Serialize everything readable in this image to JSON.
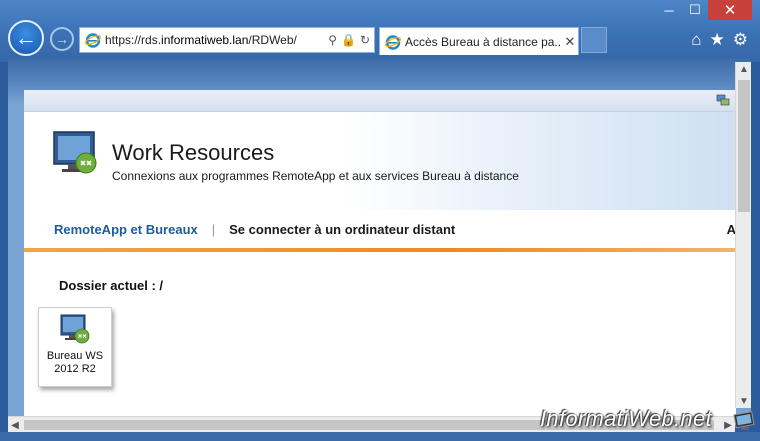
{
  "window": {
    "controls": {
      "minimize": "─",
      "maximize": "☐",
      "close": "✕"
    }
  },
  "browser": {
    "address": {
      "prefix": "https://rds.",
      "domain": "informatiweb.lan",
      "path": "/RDWeb/",
      "icons": [
        "search-icon",
        "lock-icon",
        "refresh-icon"
      ]
    },
    "tab": {
      "title": "Accès Bureau à distance pa...",
      "close": "✕"
    },
    "tools": [
      "home-icon",
      "favorites-star-icon",
      "settings-gear-icon"
    ]
  },
  "page": {
    "header": {
      "title": "Work Resources",
      "subtitle": "Connexions aux programmes RemoteApp et aux services Bureau à distance"
    },
    "tabs": {
      "remoteapp": "RemoteApp et Bureaux",
      "separator": "|",
      "connect": "Se connecter à un ordinateur distant",
      "cut": "A"
    },
    "folder": "Dossier actuel : /",
    "tiles": [
      {
        "label_line1": "Bureau WS",
        "label_line2": "2012 R2"
      }
    ]
  },
  "watermark": "InformatiWeb.net",
  "colors": {
    "accent_orange": "#f18a1a",
    "link_blue": "#1f5c99",
    "chrome_blue": "#3c73b6"
  }
}
